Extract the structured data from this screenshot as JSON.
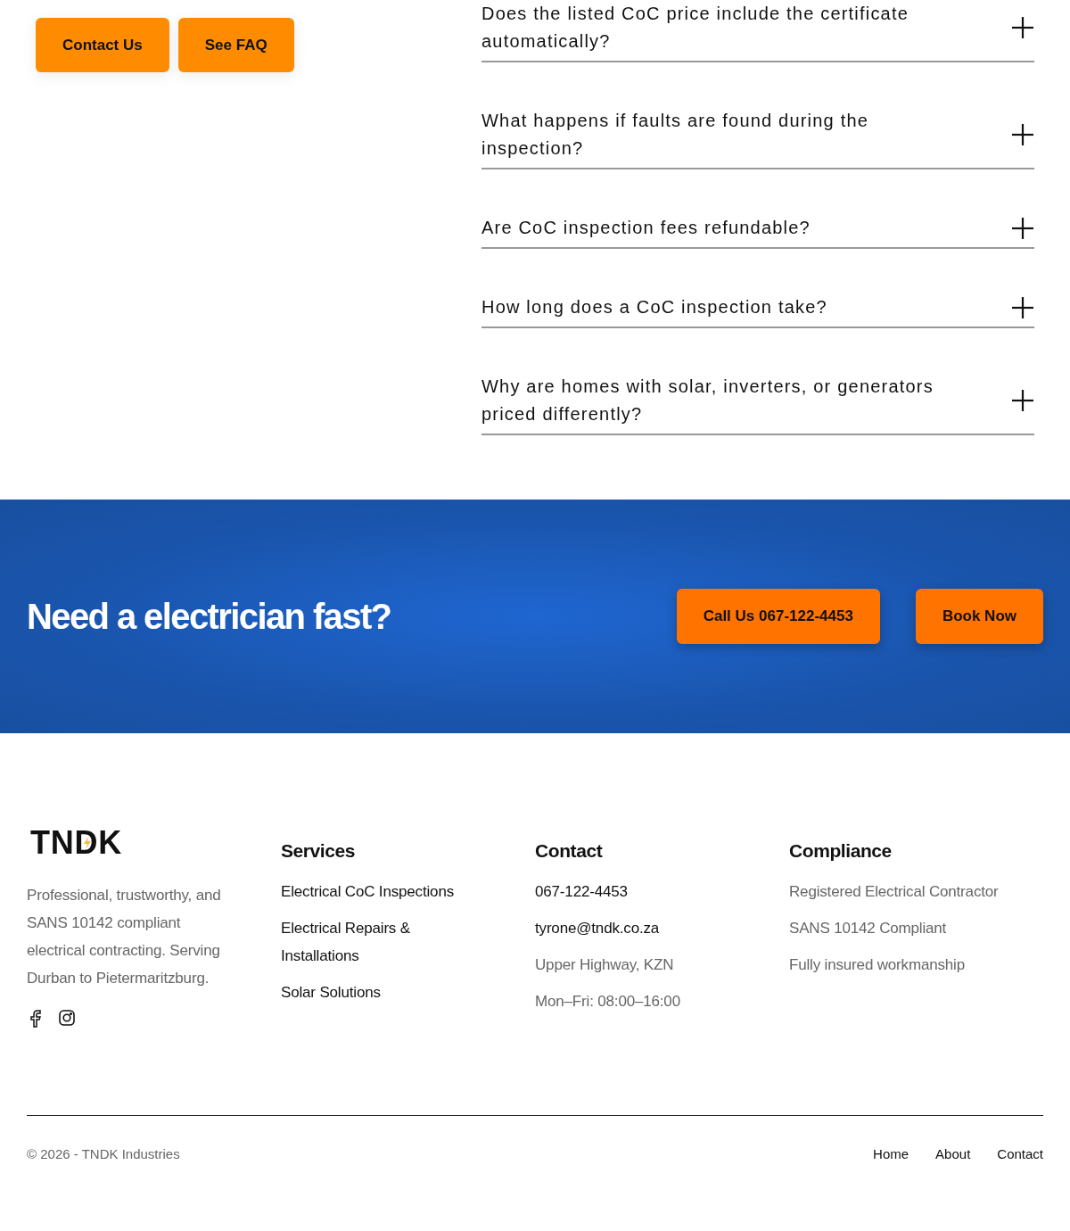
{
  "hero_buttons": [
    {
      "label": "Contact Us"
    },
    {
      "label": "See FAQ"
    }
  ],
  "faq": [
    {
      "question": "Does the listed CoC price include the certificate automatically?",
      "expanded": false
    },
    {
      "question": "What happens if faults are found during the inspection?",
      "expanded": false
    },
    {
      "question": "Are CoC inspection fees refundable?",
      "expanded": false
    },
    {
      "question": "How long does a CoC inspection take?",
      "expanded": false
    },
    {
      "question": "Why are homes with solar, inverters, or generators priced differently?",
      "expanded": false
    }
  ],
  "cta": {
    "heading": "Need a electrician fast?",
    "buttons": [
      {
        "label": "Call Us 067-122-4453"
      },
      {
        "label": "Book Now"
      }
    ]
  },
  "footer": {
    "logo": "TNDK",
    "about": "Professional, trustworthy, and SANS 10142 compliant electrical contracting. Serving Durban to Pietermaritzburg.",
    "columns": [
      {
        "title": "Services",
        "items": [
          {
            "text": "Electrical CoC Inspections",
            "kind": "link"
          },
          {
            "text": "Electrical Repairs & Installations",
            "kind": "link"
          },
          {
            "text": "Solar Solutions",
            "kind": "link"
          }
        ]
      },
      {
        "title": "Contact",
        "items": [
          {
            "text": "067-122-4453",
            "kind": "link"
          },
          {
            "text": "tyrone@tndk.co.za",
            "kind": "link"
          },
          {
            "text": "Upper Highway, KZN",
            "kind": "info"
          },
          {
            "text": "Mon–Fri: 08:00–16:00",
            "kind": "info"
          }
        ]
      },
      {
        "title": "Compliance",
        "items": [
          {
            "text": "Registered Electrical Contractor",
            "kind": "info"
          },
          {
            "text": "SANS 10142 Compliant",
            "kind": "info"
          },
          {
            "text": "Fully insured workmanship",
            "kind": "info"
          }
        ]
      }
    ],
    "copyright": "© 2026 - TNDK Industries",
    "nav": [
      "Home",
      "About",
      "Contact"
    ]
  }
}
